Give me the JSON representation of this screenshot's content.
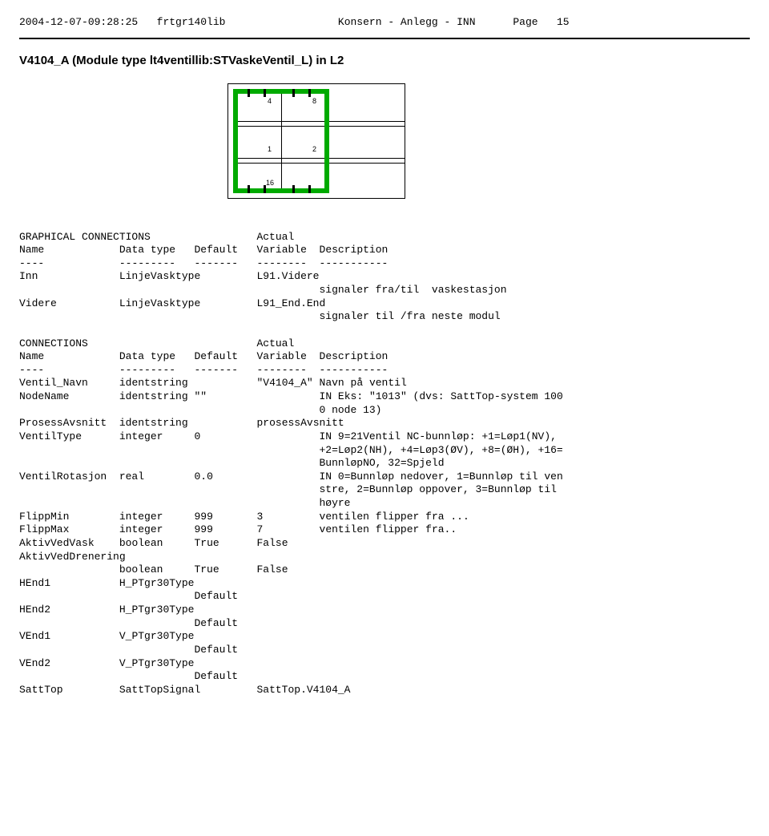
{
  "header": {
    "timestamp": "2004-12-07-09:28:25",
    "lib": "frtgr140lib",
    "center": "Konsern - Anlegg - INN",
    "page_label": "Page",
    "page_num": "15"
  },
  "title": "V4104_A (Module type lt4ventillib:STVaskeVentil_L) in L2",
  "diagram_nums": {
    "a": "4",
    "b": "8",
    "c": "1",
    "d": "2",
    "e": "16"
  },
  "sec1": {
    "heading_left": "GRAPHICAL CONNECTIONS",
    "heading_right": "Actual",
    "col_name": "Name",
    "col_type": "Data type",
    "col_def": "Default",
    "col_var": "Variable",
    "col_desc": "Description",
    "d1": "----",
    "d2": "---------",
    "d3": "-------",
    "d4": "--------",
    "d5": "-----------",
    "r1_name": "Inn",
    "r1_type": "LinjeVasktype",
    "r1_var": "L91.Videre",
    "r1_desc": "signaler fra/til  vaskestasjon",
    "r2_name": "Videre",
    "r2_type": "LinjeVasktype",
    "r2_var": "L91_End.End",
    "r2_desc": "signaler til /fra neste modul"
  },
  "sec2": {
    "heading_left": "CONNECTIONS",
    "heading_right": "Actual",
    "col_name": "Name",
    "col_type": "Data type",
    "col_def": "Default",
    "col_var": "Variable",
    "col_desc": "Description",
    "d1": "----",
    "d2": "---------",
    "d3": "-------",
    "d4": "--------",
    "d5": "-----------",
    "rows": {
      "ventil_navn": {
        "name": "Ventil_Navn",
        "type": "identstring",
        "def": "",
        "var": "\"V4104_A\"",
        "desc": "Navn på ventil"
      },
      "nodename": {
        "name": "NodeName",
        "type": "identstring",
        "def": "\"\"",
        "var": "",
        "desc1": "IN Eks: \"1013\" (dvs: SattTop-system 100",
        "desc2": "0 node 13)"
      },
      "prosess": {
        "name": "ProsessAvsnitt",
        "type": "identstring",
        "def": "",
        "var": "prosessAvsnitt",
        "desc": ""
      },
      "vtype": {
        "name": "VentilType",
        "type": "integer",
        "def": "0",
        "var": "",
        "desc1": "IN 9=21Ventil NC-bunnløp: +1=Løp1(NV),",
        "desc2": "+2=Løp2(NH), +4=Løp3(ØV), +8=(ØH), +16=",
        "desc3": "BunnløpNO, 32=Spjeld"
      },
      "vrot": {
        "name": "VentilRotasjon",
        "type": "real",
        "def": "0.0",
        "var": "",
        "desc1": "IN 0=Bunnløp nedover, 1=Bunnløp til ven",
        "desc2": "stre, 2=Bunnløp oppover, 3=Bunnløp til",
        "desc3": "høyre"
      },
      "fmin": {
        "name": "FlippMin",
        "type": "integer",
        "def": "999",
        "var": "3",
        "desc": "ventilen flipper fra ..."
      },
      "fmax": {
        "name": "FlippMax",
        "type": "integer",
        "def": "999",
        "var": "7",
        "desc": "ventilen flipper fra.."
      },
      "avv": {
        "name": "AktivVedVask",
        "type": "boolean",
        "def": "True",
        "var": "False",
        "desc": ""
      },
      "avd": {
        "name": "AktivVedDrenering",
        "type": "boolean",
        "def": "True",
        "var": "False",
        "desc": ""
      },
      "hend1": {
        "name": "HEnd1",
        "type": "H_PTgr30Type",
        "def": "Default"
      },
      "hend2": {
        "name": "HEnd2",
        "type": "H_PTgr30Type",
        "def": "Default"
      },
      "vend1": {
        "name": "VEnd1",
        "type": "V_PTgr30Type",
        "def": "Default"
      },
      "vend2": {
        "name": "VEnd2",
        "type": "V_PTgr30Type",
        "def": "Default"
      },
      "satttop": {
        "name": "SattTop",
        "type": "SattTopSignal",
        "var": "SattTop.V4104_A"
      }
    }
  }
}
